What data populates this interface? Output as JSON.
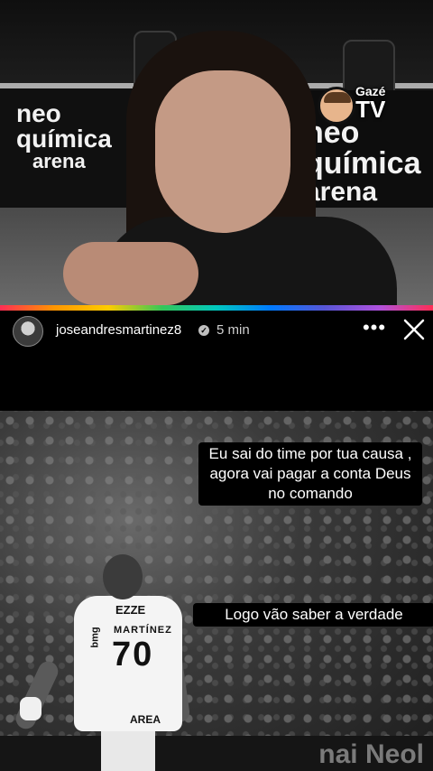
{
  "video": {
    "arena_logo_left": [
      "neo",
      "química",
      "arena"
    ],
    "arena_logo_right": [
      "neo",
      "química",
      "arena"
    ],
    "overlay_brand_top": "Gazé",
    "overlay_brand_bottom": "TV"
  },
  "header": {
    "username": "joseandresmartinez8",
    "verified_mark": "✓",
    "time": "5 min",
    "more_label": "•••"
  },
  "story": {
    "caption_1": "Eu sai do time por tua causa , agora vai pagar a conta Deus no comando",
    "caption_2": "Logo vão saber a verdade",
    "jersey": {
      "sponsor": "EZZE",
      "name": "MARTÍNEZ",
      "number": "70",
      "side": "bmg",
      "area": "AREA"
    },
    "board_text": "nai Neol"
  },
  "colors": {
    "background": "#000000",
    "progress_gradient": [
      "#ff2d55",
      "#ff9500",
      "#ffcc00",
      "#34c759",
      "#00c7be",
      "#007aff",
      "#5856d6",
      "#af52de"
    ],
    "text": "#ffffff"
  },
  "icons": {
    "more": "more-horizontal-icon",
    "close": "close-icon",
    "verified": "verified-badge-icon"
  }
}
